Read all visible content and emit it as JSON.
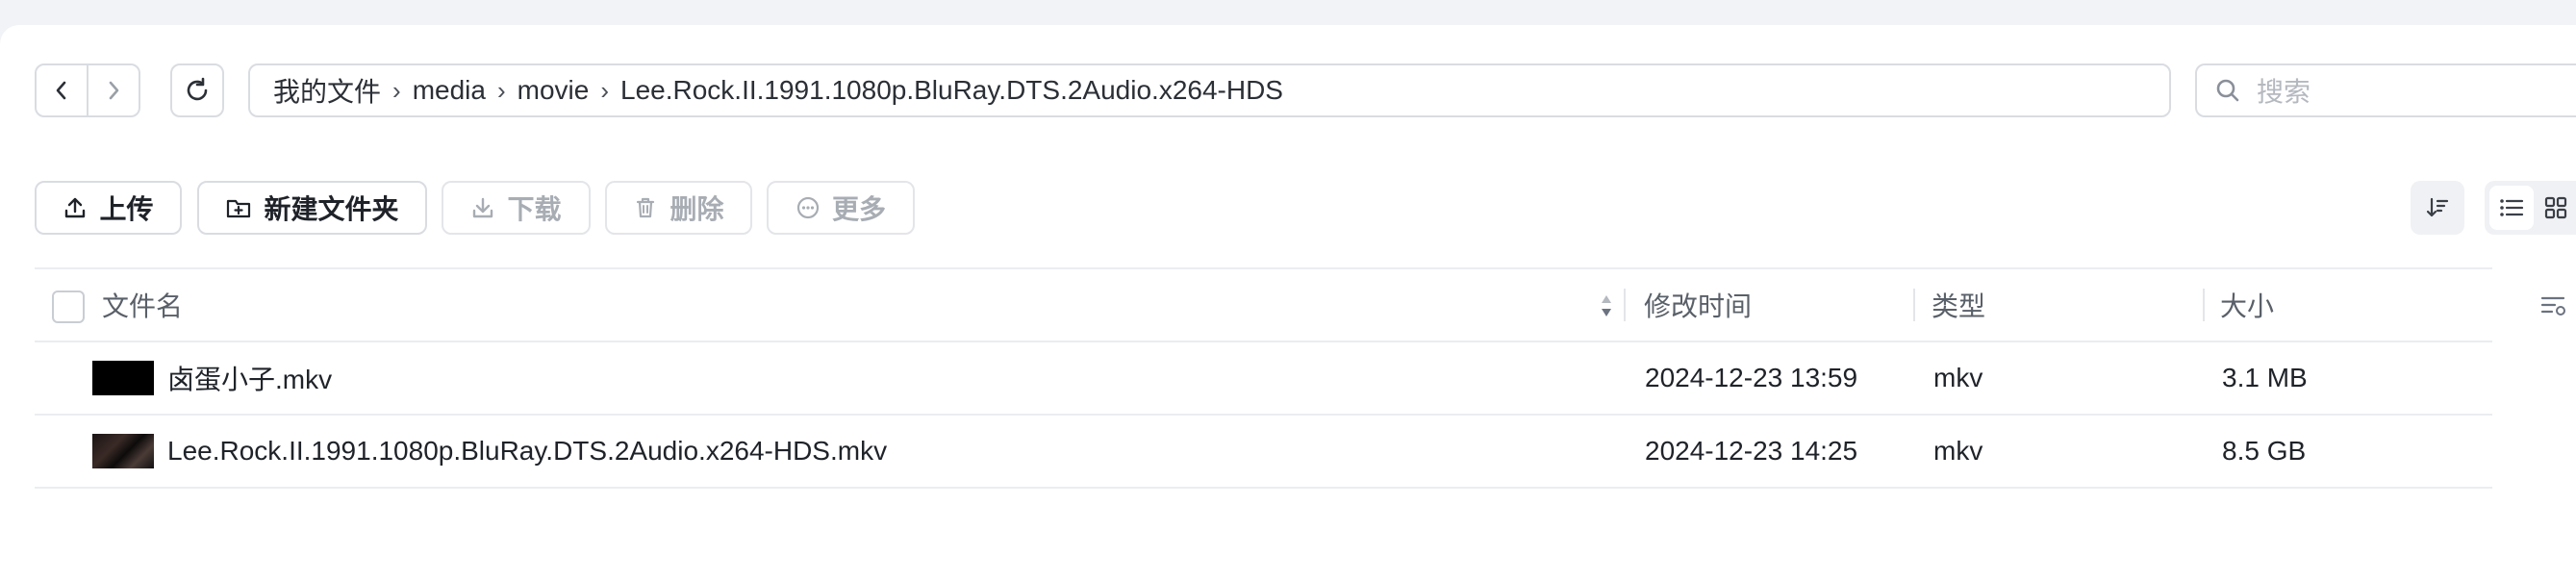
{
  "breadcrumb": [
    "我的文件",
    "media",
    "movie",
    "Lee.Rock.II.1991.1080p.BluRay.DTS.2Audio.x264-HDS"
  ],
  "breadcrumb_separator": "›",
  "search": {
    "placeholder": "搜索"
  },
  "toolbar": {
    "upload": "上传",
    "new_folder": "新建文件夹",
    "download": "下载",
    "delete": "删除",
    "more": "更多"
  },
  "table": {
    "headers": {
      "name": "文件名",
      "modified": "修改时间",
      "type": "类型",
      "size": "大小"
    },
    "rows": [
      {
        "name": "卤蛋小子.mkv",
        "modified": "2024-12-23 13:59",
        "type": "mkv",
        "size": "3.1 MB"
      },
      {
        "name": "Lee.Rock.II.1991.1080p.BluRay.DTS.2Audio.x264-HDS.mkv",
        "modified": "2024-12-23 14:25",
        "type": "mkv",
        "size": "8.5 GB"
      }
    ]
  },
  "colors": {
    "border": "#d9dce1",
    "text": "#1f2329",
    "muted": "#a8adb4",
    "background": "#f2f3f7"
  }
}
